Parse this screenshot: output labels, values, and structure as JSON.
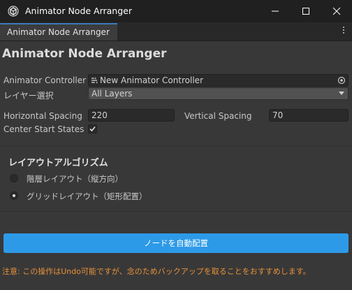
{
  "window": {
    "title": "Animator Node Arranger"
  },
  "tab": {
    "label": "Animator Node Arranger"
  },
  "heading": "Animator Node Arranger",
  "form": {
    "controller_label": "Animator Controller",
    "controller_value": "New Animator Controller",
    "layer_label": "レイヤー選択",
    "layer_value": "All Layers",
    "h_spacing_label": "Horizontal Spacing",
    "h_spacing_value": "220",
    "v_spacing_label": "Vertical Spacing",
    "v_spacing_value": "70",
    "center_label": "Center Start States",
    "center_checked": true
  },
  "algorithm": {
    "title": "レイアウトアルゴリズム",
    "options": [
      {
        "label": "階層レイアウト（縦方向）",
        "selected": false
      },
      {
        "label": "グリッドレイアウト（矩形配置）",
        "selected": true
      }
    ]
  },
  "action_label": "ノードを自動配置",
  "warning": "注意: この操作はUndo可能ですが、念のためバックアップを取ることをおすすめします。",
  "colors": {
    "accent": "#2d9ae8",
    "tab_highlight": "#3a79bb",
    "warning": "#e8913a"
  },
  "icons": [
    "unity-icon",
    "minimize-icon",
    "maximize-icon",
    "close-icon",
    "more-icon",
    "animator-controller-icon",
    "object-picker-icon",
    "dropdown-arrow-icon",
    "checkmark-icon"
  ]
}
